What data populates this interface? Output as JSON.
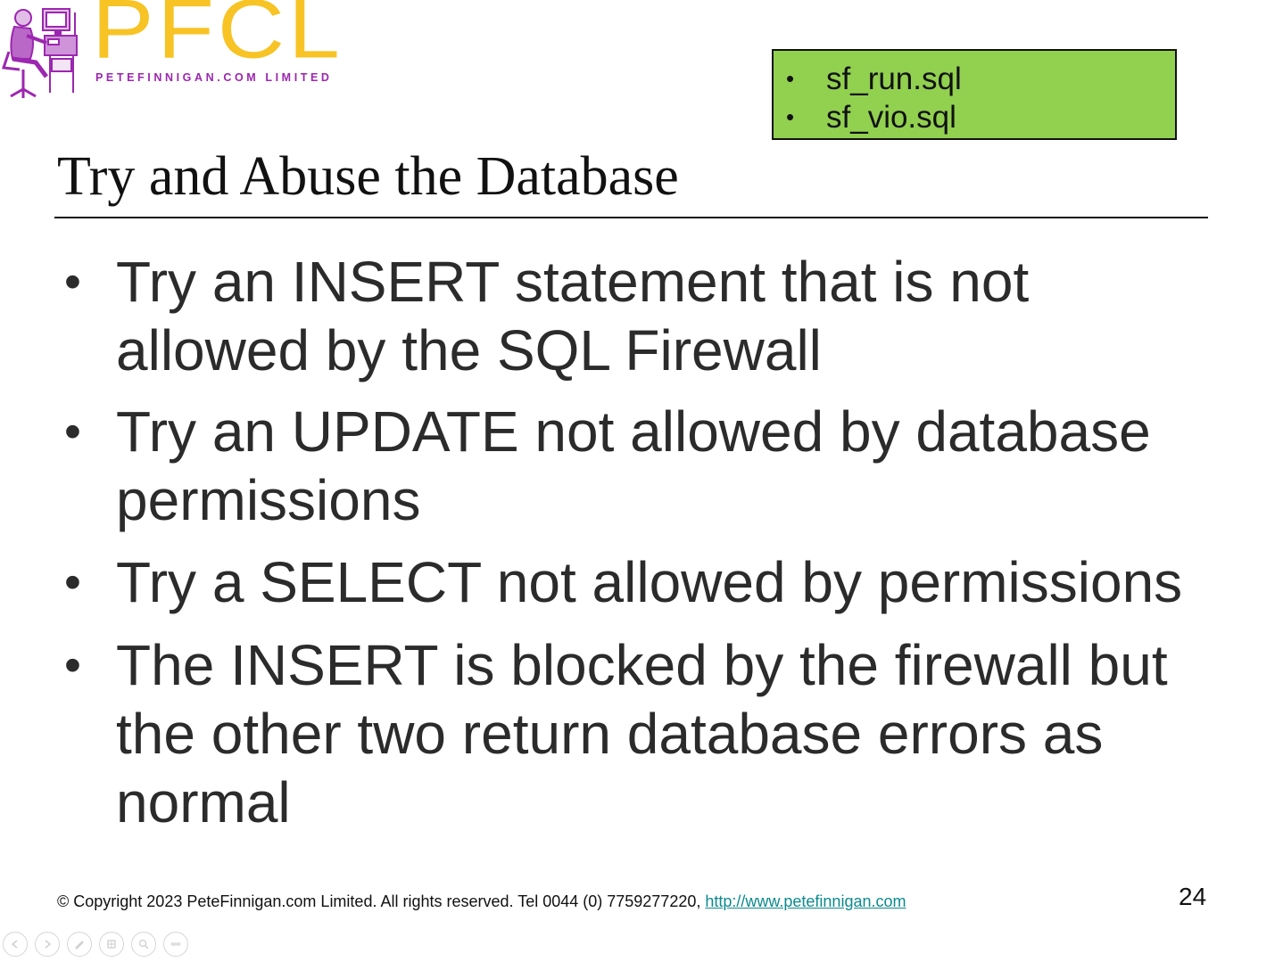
{
  "logo": {
    "wordmark": "PFCL",
    "tagline": "PETEFINNIGAN.COM LIMITED",
    "icon": "person-at-computer-icon",
    "colors": {
      "wordmark": "#f7c325",
      "tagline": "#9c27b0"
    }
  },
  "scripts_box": {
    "items": [
      "sf_run.sql",
      "sf_vio.sql"
    ],
    "background": "#92d050"
  },
  "slide": {
    "title": "Try and Abuse the Database",
    "bullets": [
      {
        "line1": "Try an INSERT statement that is not",
        "line2": "allowed by the SQL Firewall"
      },
      {
        "line1": "Try an UPDATE not allowed by database",
        "line2": "permissions"
      },
      {
        "line1": "Try a SELECT not allowed by permissions"
      },
      {
        "line1": "The INSERT is blocked by the firewall but",
        "line2": "the other two return database errors as",
        "line3": "normal"
      }
    ]
  },
  "footer": {
    "copyright": "© Copyright 2023 PeteFinnigan.com Limited. All rights reserved. Tel 0044 (0) 7759277220, ",
    "link": "http://www.petefinnigan.com",
    "page_number": "24"
  },
  "nav": {
    "buttons": [
      "previous-slide-icon",
      "next-slide-icon",
      "pen-icon",
      "slide-sorter-icon",
      "zoom-icon",
      "more-options-icon"
    ]
  }
}
